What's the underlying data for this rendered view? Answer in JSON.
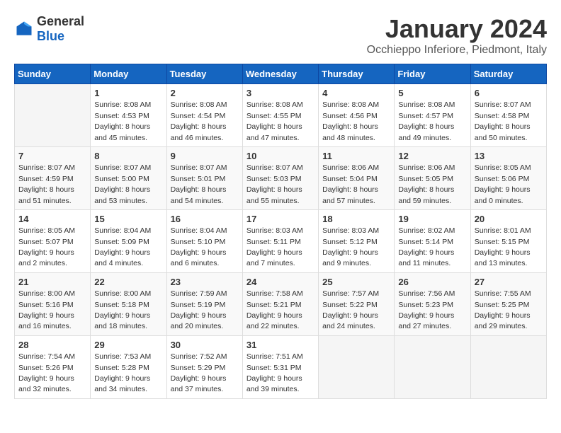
{
  "header": {
    "logo_general": "General",
    "logo_blue": "Blue",
    "title": "January 2024",
    "subtitle": "Occhieppo Inferiore, Piedmont, Italy"
  },
  "days_of_week": [
    "Sunday",
    "Monday",
    "Tuesday",
    "Wednesday",
    "Thursday",
    "Friday",
    "Saturday"
  ],
  "weeks": [
    [
      {
        "day": "",
        "empty": true
      },
      {
        "day": "1",
        "sunrise": "8:08 AM",
        "sunset": "4:53 PM",
        "daylight": "8 hours and 45 minutes."
      },
      {
        "day": "2",
        "sunrise": "8:08 AM",
        "sunset": "4:54 PM",
        "daylight": "8 hours and 46 minutes."
      },
      {
        "day": "3",
        "sunrise": "8:08 AM",
        "sunset": "4:55 PM",
        "daylight": "8 hours and 47 minutes."
      },
      {
        "day": "4",
        "sunrise": "8:08 AM",
        "sunset": "4:56 PM",
        "daylight": "8 hours and 48 minutes."
      },
      {
        "day": "5",
        "sunrise": "8:08 AM",
        "sunset": "4:57 PM",
        "daylight": "8 hours and 49 minutes."
      },
      {
        "day": "6",
        "sunrise": "8:07 AM",
        "sunset": "4:58 PM",
        "daylight": "8 hours and 50 minutes."
      }
    ],
    [
      {
        "day": "7",
        "sunrise": "8:07 AM",
        "sunset": "4:59 PM",
        "daylight": "8 hours and 51 minutes."
      },
      {
        "day": "8",
        "sunrise": "8:07 AM",
        "sunset": "5:00 PM",
        "daylight": "8 hours and 53 minutes."
      },
      {
        "day": "9",
        "sunrise": "8:07 AM",
        "sunset": "5:01 PM",
        "daylight": "8 hours and 54 minutes."
      },
      {
        "day": "10",
        "sunrise": "8:07 AM",
        "sunset": "5:03 PM",
        "daylight": "8 hours and 55 minutes."
      },
      {
        "day": "11",
        "sunrise": "8:06 AM",
        "sunset": "5:04 PM",
        "daylight": "8 hours and 57 minutes."
      },
      {
        "day": "12",
        "sunrise": "8:06 AM",
        "sunset": "5:05 PM",
        "daylight": "8 hours and 59 minutes."
      },
      {
        "day": "13",
        "sunrise": "8:05 AM",
        "sunset": "5:06 PM",
        "daylight": "9 hours and 0 minutes."
      }
    ],
    [
      {
        "day": "14",
        "sunrise": "8:05 AM",
        "sunset": "5:07 PM",
        "daylight": "9 hours and 2 minutes."
      },
      {
        "day": "15",
        "sunrise": "8:04 AM",
        "sunset": "5:09 PM",
        "daylight": "9 hours and 4 minutes."
      },
      {
        "day": "16",
        "sunrise": "8:04 AM",
        "sunset": "5:10 PM",
        "daylight": "9 hours and 6 minutes."
      },
      {
        "day": "17",
        "sunrise": "8:03 AM",
        "sunset": "5:11 PM",
        "daylight": "9 hours and 7 minutes."
      },
      {
        "day": "18",
        "sunrise": "8:03 AM",
        "sunset": "5:12 PM",
        "daylight": "9 hours and 9 minutes."
      },
      {
        "day": "19",
        "sunrise": "8:02 AM",
        "sunset": "5:14 PM",
        "daylight": "9 hours and 11 minutes."
      },
      {
        "day": "20",
        "sunrise": "8:01 AM",
        "sunset": "5:15 PM",
        "daylight": "9 hours and 13 minutes."
      }
    ],
    [
      {
        "day": "21",
        "sunrise": "8:00 AM",
        "sunset": "5:16 PM",
        "daylight": "9 hours and 16 minutes."
      },
      {
        "day": "22",
        "sunrise": "8:00 AM",
        "sunset": "5:18 PM",
        "daylight": "9 hours and 18 minutes."
      },
      {
        "day": "23",
        "sunrise": "7:59 AM",
        "sunset": "5:19 PM",
        "daylight": "9 hours and 20 minutes."
      },
      {
        "day": "24",
        "sunrise": "7:58 AM",
        "sunset": "5:21 PM",
        "daylight": "9 hours and 22 minutes."
      },
      {
        "day": "25",
        "sunrise": "7:57 AM",
        "sunset": "5:22 PM",
        "daylight": "9 hours and 24 minutes."
      },
      {
        "day": "26",
        "sunrise": "7:56 AM",
        "sunset": "5:23 PM",
        "daylight": "9 hours and 27 minutes."
      },
      {
        "day": "27",
        "sunrise": "7:55 AM",
        "sunset": "5:25 PM",
        "daylight": "9 hours and 29 minutes."
      }
    ],
    [
      {
        "day": "28",
        "sunrise": "7:54 AM",
        "sunset": "5:26 PM",
        "daylight": "9 hours and 32 minutes."
      },
      {
        "day": "29",
        "sunrise": "7:53 AM",
        "sunset": "5:28 PM",
        "daylight": "9 hours and 34 minutes."
      },
      {
        "day": "30",
        "sunrise": "7:52 AM",
        "sunset": "5:29 PM",
        "daylight": "9 hours and 37 minutes."
      },
      {
        "day": "31",
        "sunrise": "7:51 AM",
        "sunset": "5:31 PM",
        "daylight": "9 hours and 39 minutes."
      },
      {
        "day": "",
        "empty": true
      },
      {
        "day": "",
        "empty": true
      },
      {
        "day": "",
        "empty": true
      }
    ]
  ]
}
